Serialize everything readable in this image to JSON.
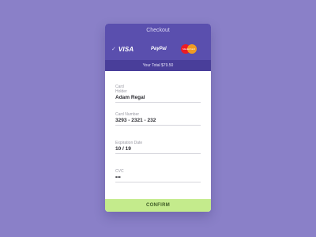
{
  "checkout": {
    "title": "Checkout",
    "payment_methods": [
      {
        "name": "VISA",
        "icon": "visa-logo",
        "selected": true
      },
      {
        "name": "PayPal",
        "icon": "paypal-logo",
        "selected": false
      },
      {
        "name": "MasterCard",
        "icon": "mastercard-logo",
        "selected": false
      }
    ],
    "total_text": "Your Total $79.50",
    "fields": {
      "card_holder": {
        "label": "Card Holder",
        "value": "Adam Regal"
      },
      "card_number": {
        "label": "Card Number",
        "value": "3293 - 2321 - 232"
      },
      "expiration": {
        "label": "Expiration Date",
        "value": "10 / 19"
      },
      "cvc": {
        "label": "CVC",
        "value": "•••"
      }
    },
    "confirm_label": "CONFIRM"
  },
  "colors": {
    "background": "#8a80c8",
    "header": "#5a4fae",
    "total_bar": "#493e9a",
    "confirm": "#c4eb8c"
  }
}
